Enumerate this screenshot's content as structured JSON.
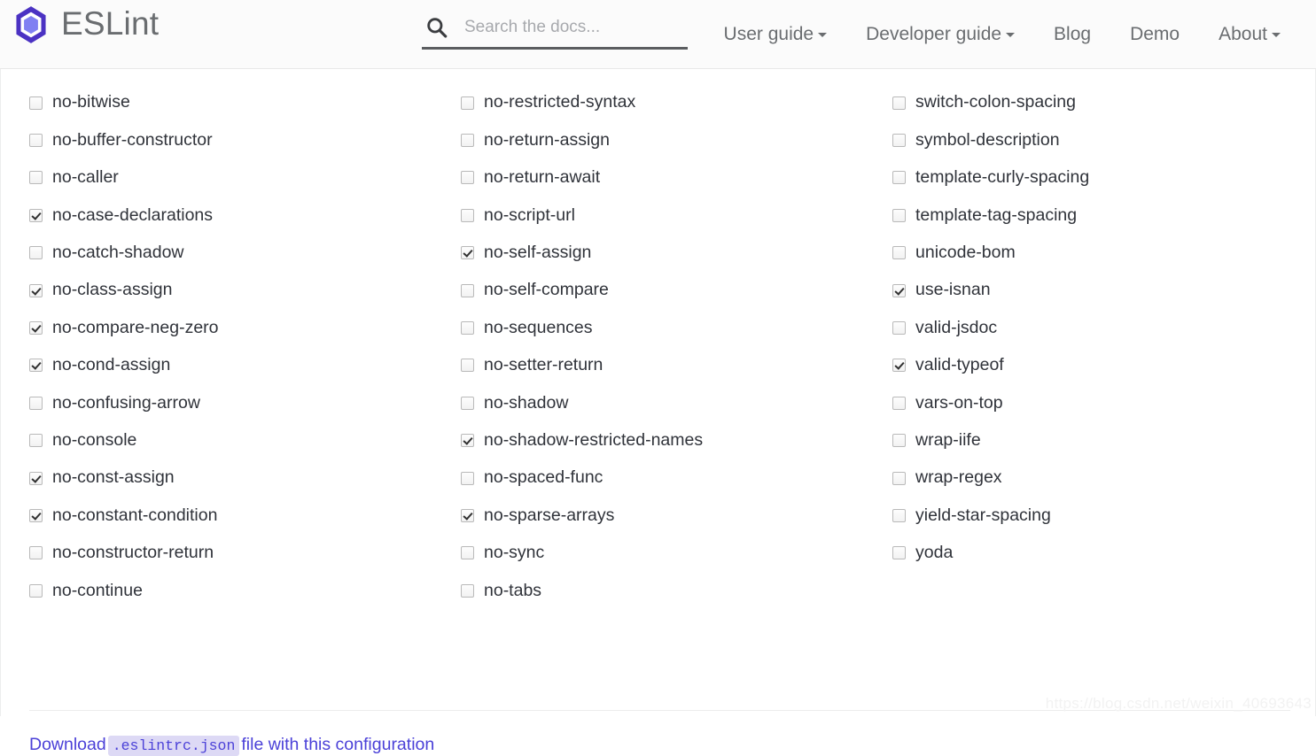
{
  "header": {
    "brand_name": "ESLint",
    "logo_icon": "eslint-hexagon-logo",
    "logo_outer_color": "#4b32c3",
    "logo_inner_color": "#8080f2",
    "search": {
      "icon": "search-icon",
      "value": "",
      "placeholder": "Search the docs..."
    },
    "nav": [
      {
        "label": "User guide",
        "has_caret": true
      },
      {
        "label": "Developer guide",
        "has_caret": true
      },
      {
        "label": "Blog",
        "has_caret": false
      },
      {
        "label": "Demo",
        "has_caret": false
      },
      {
        "label": "About",
        "has_caret": true
      }
    ]
  },
  "rules": {
    "columns": [
      {
        "items": [
          {
            "name": "no-bitwise",
            "checked": false
          },
          {
            "name": "no-buffer-constructor",
            "checked": false
          },
          {
            "name": "no-caller",
            "checked": false
          },
          {
            "name": "no-case-declarations",
            "checked": true
          },
          {
            "name": "no-catch-shadow",
            "checked": false
          },
          {
            "name": "no-class-assign",
            "checked": true
          },
          {
            "name": "no-compare-neg-zero",
            "checked": true
          },
          {
            "name": "no-cond-assign",
            "checked": true
          },
          {
            "name": "no-confusing-arrow",
            "checked": false
          },
          {
            "name": "no-console",
            "checked": false
          },
          {
            "name": "no-const-assign",
            "checked": true
          },
          {
            "name": "no-constant-condition",
            "checked": true
          },
          {
            "name": "no-constructor-return",
            "checked": false
          },
          {
            "name": "no-continue",
            "checked": false
          }
        ]
      },
      {
        "items": [
          {
            "name": "no-restricted-syntax",
            "checked": false
          },
          {
            "name": "no-return-assign",
            "checked": false
          },
          {
            "name": "no-return-await",
            "checked": false
          },
          {
            "name": "no-script-url",
            "checked": false
          },
          {
            "name": "no-self-assign",
            "checked": true
          },
          {
            "name": "no-self-compare",
            "checked": false
          },
          {
            "name": "no-sequences",
            "checked": false
          },
          {
            "name": "no-setter-return",
            "checked": false
          },
          {
            "name": "no-shadow",
            "checked": false
          },
          {
            "name": "no-shadow-restricted-names",
            "checked": true
          },
          {
            "name": "no-spaced-func",
            "checked": false
          },
          {
            "name": "no-sparse-arrays",
            "checked": true
          },
          {
            "name": "no-sync",
            "checked": false
          },
          {
            "name": "no-tabs",
            "checked": false
          }
        ]
      },
      {
        "items": [
          {
            "name": "switch-colon-spacing",
            "checked": false
          },
          {
            "name": "symbol-description",
            "checked": false
          },
          {
            "name": "template-curly-spacing",
            "checked": false
          },
          {
            "name": "template-tag-spacing",
            "checked": false
          },
          {
            "name": "unicode-bom",
            "checked": false
          },
          {
            "name": "use-isnan",
            "checked": true
          },
          {
            "name": "valid-jsdoc",
            "checked": false
          },
          {
            "name": "valid-typeof",
            "checked": true
          },
          {
            "name": "vars-on-top",
            "checked": false
          },
          {
            "name": "wrap-iife",
            "checked": false
          },
          {
            "name": "wrap-regex",
            "checked": false
          },
          {
            "name": "yield-star-spacing",
            "checked": false
          },
          {
            "name": "yoda",
            "checked": false
          }
        ]
      }
    ]
  },
  "footer": {
    "download_label": "Download",
    "download_code": ".eslintrc.json",
    "download_tail": "file with this configuration",
    "link_color": "#4b41d8"
  },
  "watermark": "https://blog.csdn.net/weixin_40693643"
}
